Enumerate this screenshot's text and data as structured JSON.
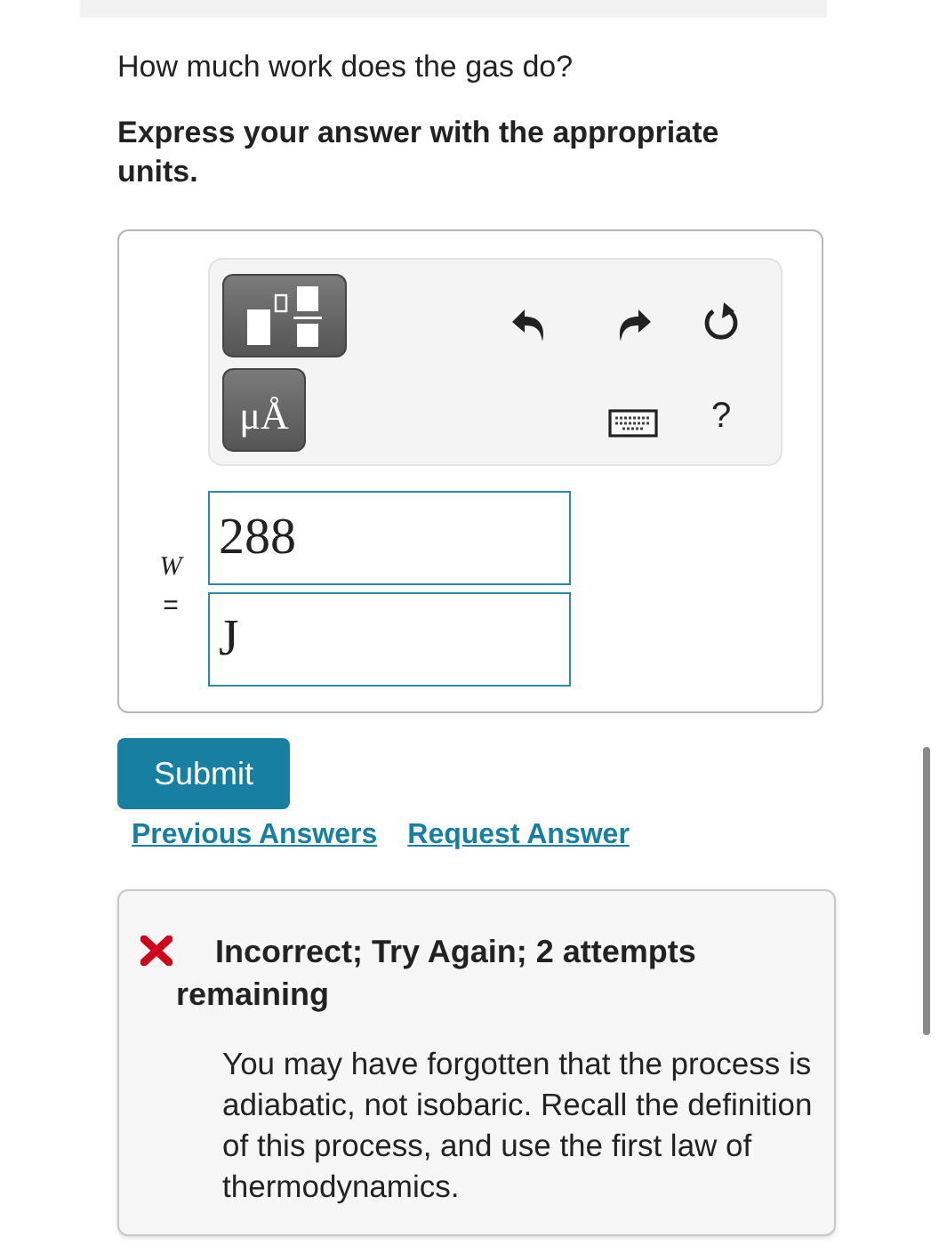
{
  "question": "How much work does the gas do?",
  "instruction": "Express your answer with the appropriate units.",
  "toolbar": {
    "units_button": "μÅ",
    "help": "?"
  },
  "answer": {
    "variable": "W",
    "equals": "=",
    "value": "288",
    "units": "J"
  },
  "submit": "Submit",
  "links": [
    "Previous Answers",
    "Request Answer"
  ],
  "feedback": {
    "kind": "incorrect",
    "title": "Incorrect; Try Again; 2 attempts remaining",
    "message": "You may have forgotten that the process is adiabatic, not isobaric. Recall the definition of this process, and use the first law of thermodynamics."
  }
}
